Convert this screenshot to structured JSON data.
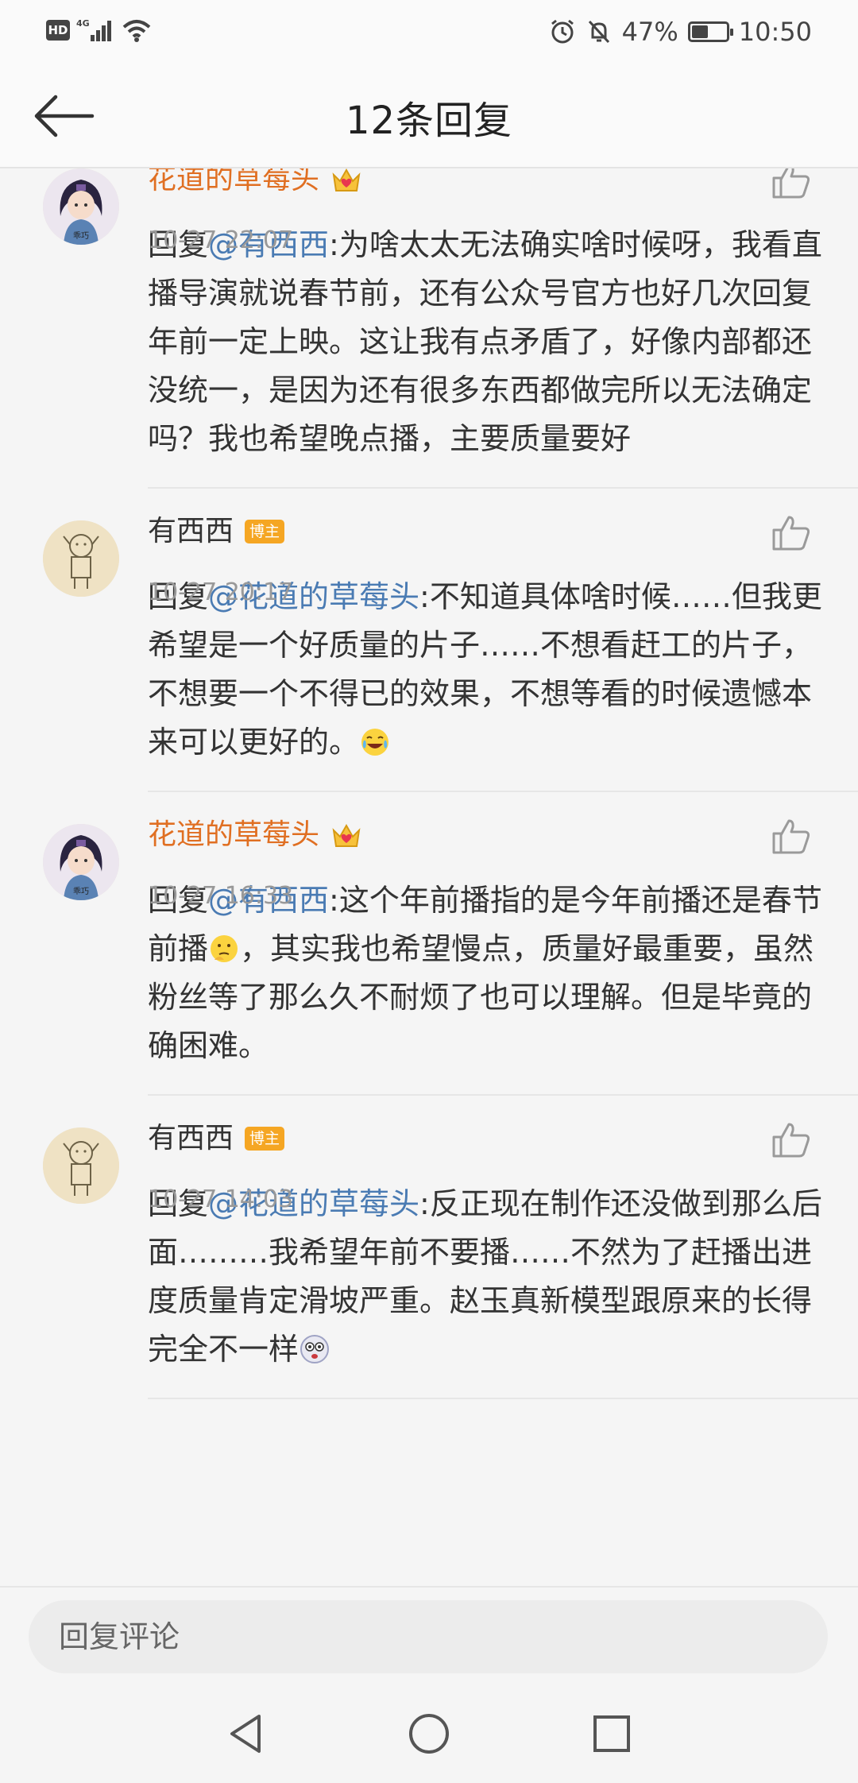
{
  "status_bar": {
    "hd": "HD",
    "network": "4G",
    "battery_text": "47%",
    "battery_level": 0.47,
    "time": "10:50"
  },
  "header": {
    "title": "12条回复"
  },
  "comments": [
    {
      "author": "花道的草莓头",
      "author_type": "vip",
      "badge": "",
      "time": "10-27 22:07",
      "prefix": "回复",
      "mention": "@有西西",
      "text": ":为啥太太无法确实啥时候呀，我看直播导演就说春节前，还有公众号官方也好几次回复年前一定上映。这让我有点矛盾了，好像内部都还没统一，是因为还有很多东西都做完所以无法确定吗？我也希望晚点播，主要质量要好",
      "emoji": ""
    },
    {
      "author": "有西西",
      "author_type": "normal",
      "badge": "博主",
      "time": "10-27 20:17",
      "prefix": "回复",
      "mention": "@花道的草莓头",
      "text": ":不知道具体啥时候……但我更希望是一个好质量的片子……不想看赶工的片子，不想要一个不得已的效果，不想等看的时候遗憾本来可以更好的。",
      "emoji": "laugh-cry-emoji"
    },
    {
      "author": "花道的草莓头",
      "author_type": "vip",
      "badge": "",
      "time": "10-27 16:33",
      "prefix": "回复",
      "mention": "@有西西",
      "text_before": ":这个年前播指的是今年前播还是春节前播",
      "text": "，其实我也希望慢点，质量好最重要，虽然粉丝等了那么久不耐烦了也可以理解。但是毕竟的确困难。",
      "emoji": "thinking-emoji"
    },
    {
      "author": "有西西",
      "author_type": "normal",
      "badge": "博主",
      "time": "10-27 14:03",
      "prefix": "回复",
      "mention": "@花道的草莓头",
      "text": ":反正现在制作还没做到那么后面………我希望年前不要播……不然为了赶播出进度质量肯定滑坡严重。赵玉真新模型跟原来的长得完全不一样",
      "emoji": "dizzy-face-emoji"
    }
  ],
  "input": {
    "placeholder": "回复评论"
  },
  "colors": {
    "vip_name": "#e06f22",
    "mention": "#4a7bb3",
    "host_badge": "#f5a623"
  }
}
